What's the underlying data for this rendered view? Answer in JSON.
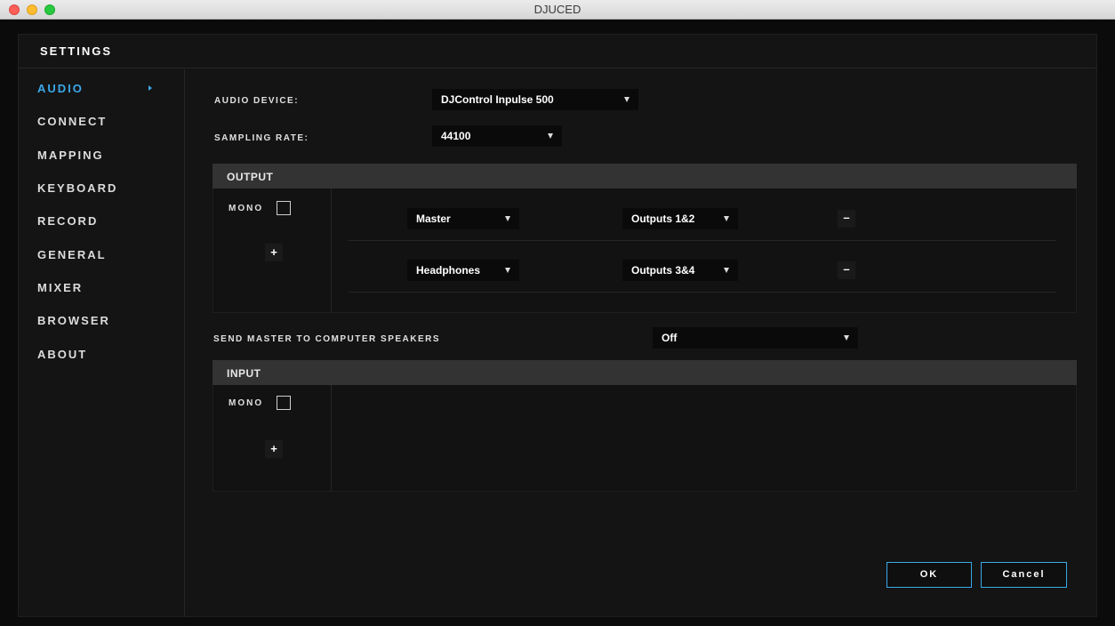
{
  "window": {
    "title": "DJUCED"
  },
  "panel": {
    "title": "SETTINGS"
  },
  "sidebar": {
    "items": [
      {
        "label": "AUDIO",
        "active": true
      },
      {
        "label": "CONNECT"
      },
      {
        "label": "MAPPING"
      },
      {
        "label": "KEYBOARD"
      },
      {
        "label": "RECORD"
      },
      {
        "label": "GENERAL"
      },
      {
        "label": "MIXER"
      },
      {
        "label": "BROWSER"
      },
      {
        "label": "ABOUT"
      }
    ]
  },
  "audio": {
    "device_label": "AUDIO DEVICE:",
    "device_value": "DJControl Inpulse 500",
    "sampling_label": "SAMPLING RATE:",
    "sampling_value": "44100",
    "output": {
      "title": "OUTPUT",
      "mono_label": "MONO",
      "plus_label": "+",
      "rows": [
        {
          "channel": "Master",
          "outputs": "Outputs 1&2",
          "minus_label": "–"
        },
        {
          "channel": "Headphones",
          "outputs": "Outputs 3&4",
          "minus_label": "–"
        }
      ]
    },
    "send_master_label": "SEND MASTER TO COMPUTER SPEAKERS",
    "send_master_value": "Off",
    "input": {
      "title": "INPUT",
      "mono_label": "MONO",
      "plus_label": "+"
    }
  },
  "buttons": {
    "ok": "OK",
    "cancel": "Cancel"
  },
  "colors": {
    "accent": "#3ba8e8",
    "background": "#141414",
    "section_bar": "#333333"
  }
}
